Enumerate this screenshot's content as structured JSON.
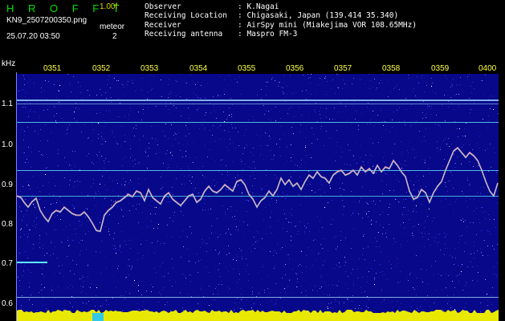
{
  "header": {
    "logo": "H R O F F T",
    "version": "1.00f",
    "filename": "KN9_2507200350.png",
    "datetime": "25.07.20 03:50",
    "meteor_label": "meteor",
    "meteor_count": "2"
  },
  "info": [
    {
      "key": "Observer",
      "value": ": K.Nagai"
    },
    {
      "key": "Receiving Location",
      "value": ": Chigasaki, Japan (139.414 35.340)"
    },
    {
      "key": "Receiver",
      "value": ": AirSpy mini (Miakejima VOR 108.65MHz)"
    },
    {
      "key": "Receiving antenna",
      "value": ": Maspro FM-3"
    }
  ],
  "axis": {
    "unit": "kHz",
    "time_ticks": [
      "0351",
      "0352",
      "0353",
      "0354",
      "0355",
      "0356",
      "0357",
      "0358",
      "0359",
      "0400"
    ],
    "freq_ticks": [
      "1.1",
      "1.0",
      "0.9",
      "0.8",
      "0.7",
      "0.6"
    ]
  },
  "colors": {
    "background": "#08088a",
    "trace": "#e8a0c0",
    "carrier": "#60e8ff",
    "baseline": "#e8e800",
    "header_text": "#ffffff",
    "logo": "#00e000",
    "tick": "#ffff40"
  }
}
